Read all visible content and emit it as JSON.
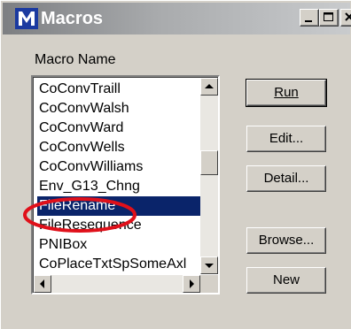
{
  "window": {
    "title": "Macros"
  },
  "list": {
    "label": "Macro Name",
    "items": [
      "CoConvTraill",
      "CoConvWalsh",
      "CoConvWard",
      "CoConvWells",
      "CoConvWilliams",
      "Env_G13_Chng",
      "FileRename",
      "FileResequence",
      "PNIBox",
      "CoPlaceTxtSpSomeAxl"
    ],
    "selected": "FileRename"
  },
  "buttons": {
    "run": {
      "label": "Run"
    },
    "edit": {
      "label": "Edit..."
    },
    "detail": {
      "label": "Detail..."
    },
    "browse": {
      "label": "Browse..."
    },
    "new": {
      "label": "New"
    }
  },
  "colors": {
    "selection": "#0a246a",
    "annotation": "#e0101a"
  }
}
